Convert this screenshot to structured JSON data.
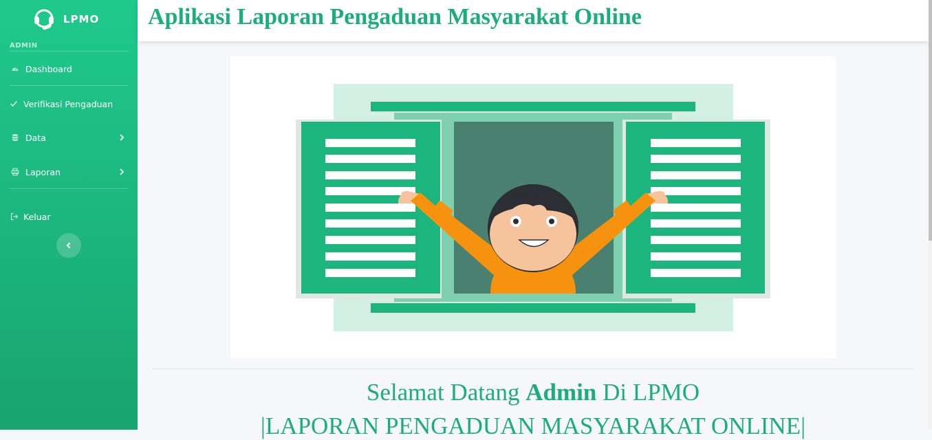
{
  "sidebar": {
    "brand": "LPMO",
    "brand_icon": "headset-icon",
    "heading": "ADMIN",
    "items": [
      {
        "label": "Dashboard",
        "icon": "tachometer-icon"
      },
      {
        "label": "Verifikasi Pengaduan",
        "icon": "check-icon"
      },
      {
        "label": "Data",
        "icon": "database-icon",
        "has_submenu": true
      },
      {
        "label": "Laporan",
        "icon": "print-icon",
        "has_submenu": true
      },
      {
        "label": "Keluar",
        "icon": "sign-out-icon"
      }
    ],
    "toggle_icon": "chevron-left-icon"
  },
  "header": {
    "title": "Aplikasi Laporan Pengaduan Masyarakat Online"
  },
  "main": {
    "illustration": "person-opening-window-illustration",
    "welcome_prefix": "Selamat Datang ",
    "welcome_user": "Admin",
    "welcome_suffix": " Di LPMO",
    "subtitle": "|LAPORAN PENGADUAN MASYARAKAT ONLINE|"
  },
  "colors": {
    "accent": "#1cad7a",
    "sidebar_top": "#1fc98b",
    "sidebar_bottom": "#18a46f",
    "background": "#f6f7fb"
  }
}
